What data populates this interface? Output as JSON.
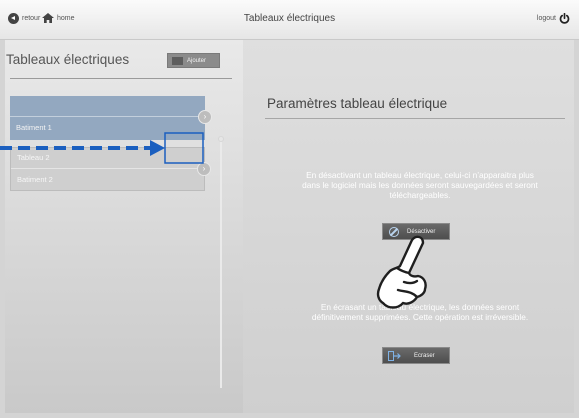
{
  "topbar": {
    "back_label": "retour",
    "home_label": "home",
    "title": "Tableaux électriques",
    "logout_label": "logout"
  },
  "left": {
    "title": "Tableaux électriques",
    "add_label": "Ajouter",
    "items": [
      {
        "name": "",
        "building": "Batiment 1"
      },
      {
        "name": "Tableau 2",
        "building": "Batiment 2"
      }
    ]
  },
  "right": {
    "title": "Paramètres tableau électrique",
    "deactivate_text": "En désactivant un tableau électrique, celui-ci n’apparaitra plus dans le logiciel mais les données seront sauvegardées et seront téléchargeables.",
    "deactivate_label": "Désactiver",
    "overwrite_text": "En écrasant un tableau électrique, les données seront définitivement supprimées. Cette opération est irréversible.",
    "overwrite_label": "Ecraser"
  },
  "colors": {
    "selected_item": "#93a8c0",
    "highlight_blue": "#1b5fbf",
    "button_dark": "#555555"
  },
  "icons": [
    "back-arrow-icon",
    "home-icon",
    "power-icon",
    "plus-icon",
    "chevron-right-icon",
    "circle-slash-icon",
    "overwrite-icon",
    "hand-pointer-icon"
  ]
}
